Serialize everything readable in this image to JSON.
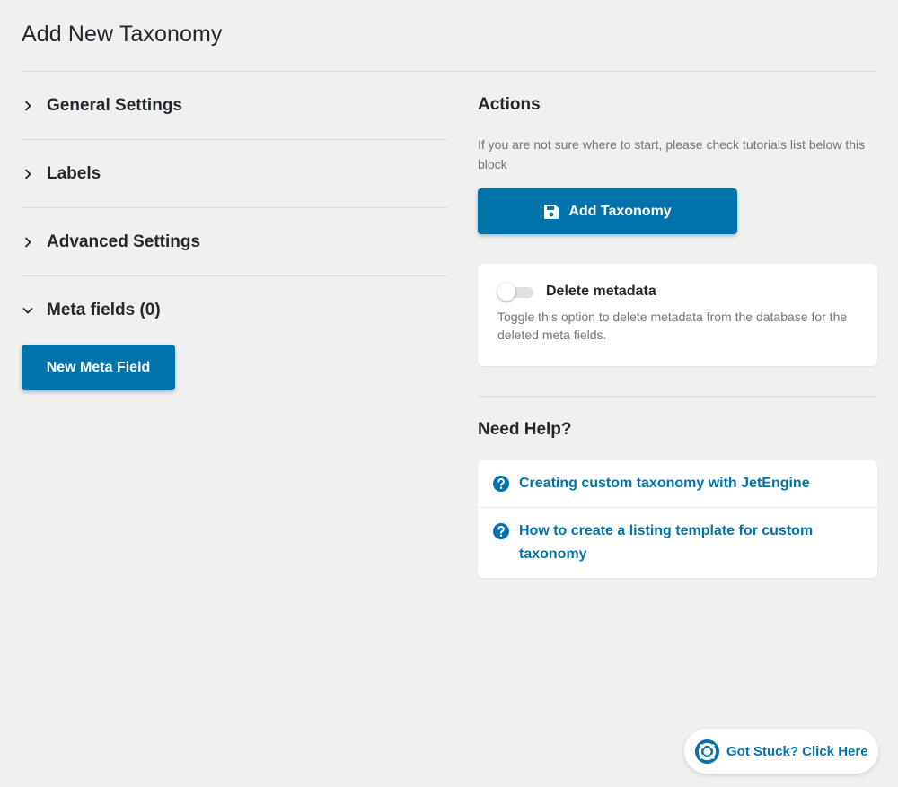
{
  "page": {
    "title": "Add New Taxonomy"
  },
  "left": {
    "sections": [
      {
        "label": "General Settings",
        "expanded": false
      },
      {
        "label": "Labels",
        "expanded": false
      },
      {
        "label": "Advanced Settings",
        "expanded": false
      },
      {
        "label": "Meta fields (0)",
        "expanded": true
      }
    ],
    "new_meta_field_label": "New Meta Field"
  },
  "actions": {
    "title": "Actions",
    "description": "If you are not sure where to start, please check tutorials list below this block",
    "add_taxonomy_label": "Add Taxonomy",
    "save_icon": "floppy-disk-icon"
  },
  "delete_metadata": {
    "label": "Delete metadata",
    "enabled": false,
    "description": "Toggle this option to delete metadata from the database for the deleted meta fields."
  },
  "help": {
    "title": "Need Help?",
    "links": [
      {
        "label": "Creating custom taxonomy with JetEngine",
        "icon": "question-circle-icon"
      },
      {
        "label": "How to create a listing template for custom taxonomy",
        "icon": "question-circle-icon"
      }
    ]
  },
  "stuck": {
    "label": "Got Stuck? Click Here",
    "icon": "lifebuoy-icon"
  },
  "colors": {
    "accent": "#0073aa",
    "background": "#f0f0f1",
    "text": "#23282d",
    "muted": "#757575"
  }
}
